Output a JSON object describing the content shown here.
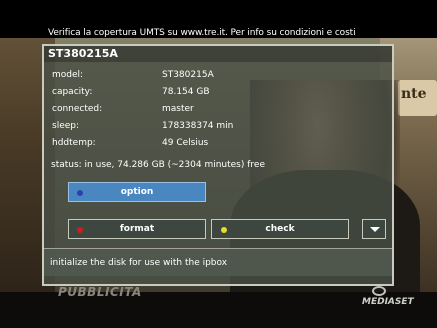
{
  "banner": {
    "text": "Verifica la copertura UMTS su www.tre.it. Per info su condizioni e costi"
  },
  "panel": {
    "title": "ST380215A",
    "rows": [
      {
        "label": "model:",
        "value": "ST380215A"
      },
      {
        "label": "capacity:",
        "value": "78.154 GB"
      },
      {
        "label": "connected:",
        "value": "master"
      },
      {
        "label": "sleep:",
        "value": "178338374 min"
      },
      {
        "label": "hddtemp:",
        "value": "49  Celsius"
      }
    ],
    "status": "status:  in use, 74.286 GB (~2304 minutes) free"
  },
  "buttons": {
    "option": "option",
    "format": "format",
    "check": "check"
  },
  "colors": {
    "option_dot": "#2f3fae",
    "format_dot": "#d01c1c",
    "check_dot": "#e6de2c"
  },
  "help": "initialize the disk for use with the ipbox",
  "watermarks": {
    "left": "PUBBLICITA",
    "right": "MEDIASET"
  },
  "background": {
    "sign_text": "nte"
  }
}
